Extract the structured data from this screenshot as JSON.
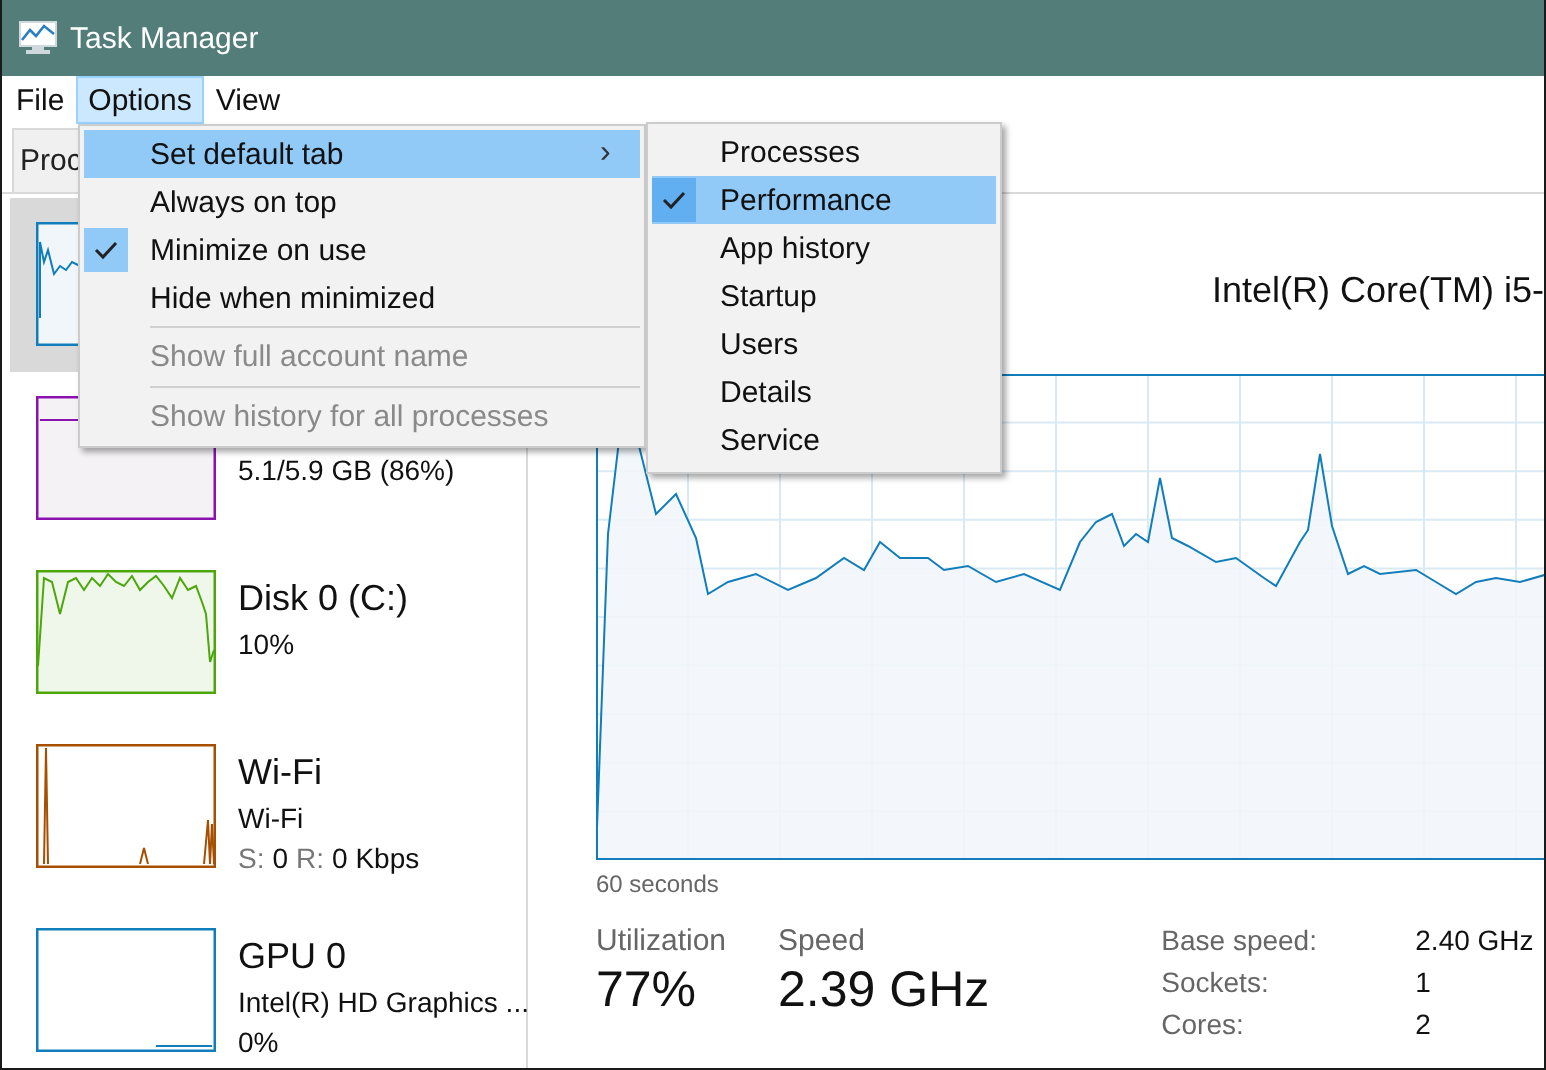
{
  "window": {
    "title": "Task Manager"
  },
  "menu_bar": [
    {
      "label": "File",
      "selected": false
    },
    {
      "label": "Options",
      "selected": true
    },
    {
      "label": "View",
      "selected": false
    }
  ],
  "tabs": [
    {
      "label": "Proc",
      "selected": false
    }
  ],
  "sidebar": {
    "items": [
      {
        "kind": "cpu",
        "selected": true,
        "color": "#117dbb"
      },
      {
        "kind": "memory",
        "selected": false,
        "color": "#8b12ae",
        "lines": [
          "5.1/5.9 GB (86%)"
        ]
      },
      {
        "kind": "disk",
        "selected": false,
        "color": "#4da60c",
        "name": "Disk 0 (C:)",
        "lines": [
          "10%"
        ]
      },
      {
        "kind": "network",
        "selected": false,
        "color": "#a74f01",
        "name": "Wi-Fi",
        "lines": [
          "Wi-Fi"
        ],
        "rates": [
          {
            "label": "S:",
            "value": "0"
          },
          {
            "label": "R:",
            "value": "0 Kbps"
          }
        ]
      },
      {
        "kind": "gpu",
        "selected": false,
        "color": "#117dbb",
        "name": "GPU 0",
        "lines": [
          "Intel(R) HD Graphics ...",
          "0%"
        ]
      }
    ]
  },
  "main": {
    "cpu_name": "Intel(R) Core(TM) i5-",
    "graph_caption": "60 seconds",
    "stats": [
      {
        "label": "Utilization",
        "value": "77%"
      },
      {
        "label": "Speed",
        "value": "2.39 GHz"
      }
    ],
    "specs": [
      {
        "label": "Base speed:",
        "value": "2.40 GHz"
      },
      {
        "label": "Sockets:",
        "value": "1"
      },
      {
        "label": "Cores:",
        "value": "2"
      }
    ]
  },
  "options_menu": {
    "items": [
      {
        "kind": "submenu",
        "label": "Set default tab",
        "arrow": "›",
        "selected": true,
        "checked": false,
        "disabled": false
      },
      {
        "kind": "item",
        "label": "Always on top",
        "selected": false,
        "checked": false,
        "disabled": false
      },
      {
        "kind": "item",
        "label": "Minimize on use",
        "selected": false,
        "checked": true,
        "disabled": false
      },
      {
        "kind": "item",
        "label": "Hide when minimized",
        "selected": false,
        "checked": false,
        "disabled": false
      },
      {
        "kind": "separator"
      },
      {
        "kind": "item",
        "label": "Show full account name",
        "selected": false,
        "checked": false,
        "disabled": true
      },
      {
        "kind": "separator"
      },
      {
        "kind": "item",
        "label": "Show history for all processes",
        "selected": false,
        "checked": false,
        "disabled": true
      }
    ]
  },
  "default_tab_submenu": {
    "items": [
      {
        "label": "Processes",
        "selected": false,
        "checked": false
      },
      {
        "label": "Performance",
        "selected": true,
        "checked": true
      },
      {
        "label": "App history",
        "selected": false,
        "checked": false
      },
      {
        "label": "Startup",
        "selected": false,
        "checked": false
      },
      {
        "label": "Users",
        "selected": false,
        "checked": false
      },
      {
        "label": "Details",
        "selected": false,
        "checked": false
      },
      {
        "label": "Service",
        "selected": false,
        "checked": false
      }
    ]
  }
}
